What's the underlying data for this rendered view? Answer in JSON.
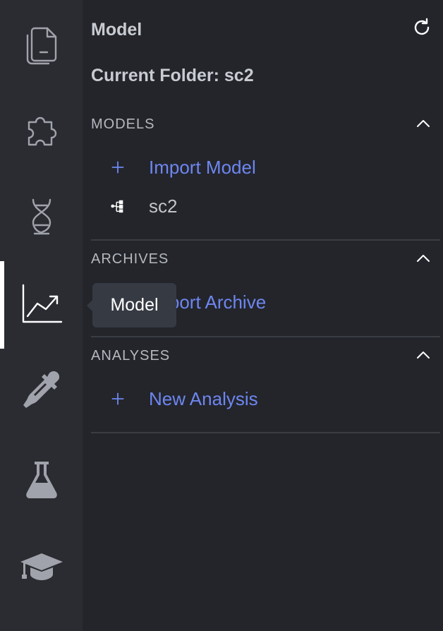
{
  "activity_bar": {
    "items": [
      {
        "icon": "file-document-icon",
        "active": false
      },
      {
        "icon": "puzzle-piece-icon",
        "active": false
      },
      {
        "icon": "dna-icon",
        "active": false
      },
      {
        "icon": "chart-line-icon",
        "active": true
      },
      {
        "icon": "eyedropper-icon",
        "active": false
      },
      {
        "icon": "flask-icon",
        "active": false
      },
      {
        "icon": "graduation-cap-icon",
        "active": false
      }
    ]
  },
  "panel": {
    "title": "Model",
    "refresh_icon": "refresh-icon",
    "current_folder": "Current Folder: sc2"
  },
  "sections": {
    "models": {
      "title": "MODELS",
      "items": [
        {
          "label": "Import Model",
          "icon": "plus-icon",
          "kind": "action"
        },
        {
          "label": "sc2",
          "icon": "model-tree-icon",
          "kind": "item"
        }
      ]
    },
    "archives": {
      "title": "ARCHIVES",
      "items": [
        {
          "label": "Import Archive",
          "icon": "plus-icon",
          "kind": "action"
        }
      ]
    },
    "analyses": {
      "title": "ANALYSES",
      "items": [
        {
          "label": "New Analysis",
          "icon": "plus-icon",
          "kind": "action"
        }
      ]
    }
  },
  "tooltip": {
    "text": "Model"
  },
  "colors": {
    "background": "#23252b",
    "activity_bar": "#2a2c32",
    "link": "#6e86f0",
    "text": "#c8cbd2",
    "tooltip_bg": "#363a42"
  }
}
